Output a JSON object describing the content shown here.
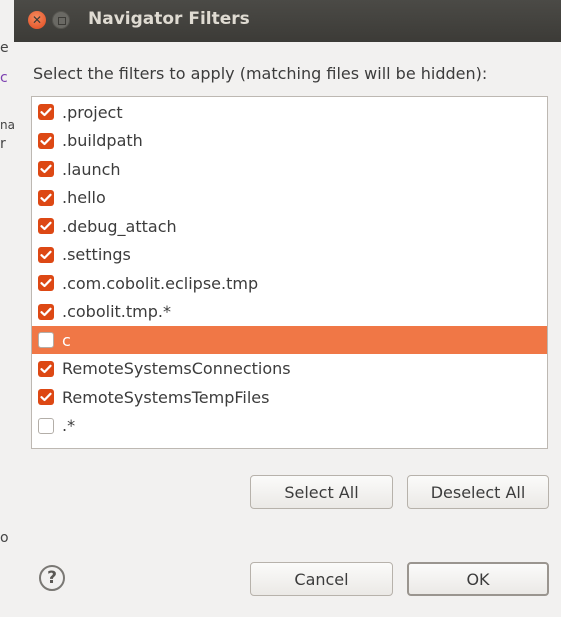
{
  "window": {
    "title": "Navigator Filters"
  },
  "dialog": {
    "instruction": "Select the filters to apply (matching files will be hidden):",
    "filters": [
      {
        "label": ".project",
        "checked": true,
        "selected": false
      },
      {
        "label": ".buildpath",
        "checked": true,
        "selected": false
      },
      {
        "label": ".launch",
        "checked": true,
        "selected": false
      },
      {
        "label": ".hello",
        "checked": true,
        "selected": false
      },
      {
        "label": ".debug_attach",
        "checked": true,
        "selected": false
      },
      {
        "label": ".settings",
        "checked": true,
        "selected": false
      },
      {
        "label": ".com.cobolit.eclipse.tmp",
        "checked": true,
        "selected": false
      },
      {
        "label": ".cobolit.tmp.*",
        "checked": true,
        "selected": false
      },
      {
        "label": "c",
        "checked": false,
        "selected": true
      },
      {
        "label": "RemoteSystemsConnections",
        "checked": true,
        "selected": false
      },
      {
        "label": "RemoteSystemsTempFiles",
        "checked": true,
        "selected": false
      },
      {
        "label": ".*",
        "checked": false,
        "selected": false
      }
    ],
    "select_all_label": "Select All",
    "deselect_all_label": "Deselect All",
    "cancel_label": "Cancel",
    "ok_label": "OK",
    "help_glyph": "?"
  },
  "icons": {
    "close": "close-icon",
    "minimize": "minimize-icon",
    "help": "help-icon",
    "checkbox_checked": "checkbox-checked-icon",
    "checkbox_unchecked": "checkbox-unchecked-icon"
  },
  "colors": {
    "accent": "#dd4814",
    "selection": "#f07746",
    "titlebar": "#3c3b37"
  },
  "backdrop": {
    "fragments": [
      "e",
      "c",
      "na",
      "r",
      "o"
    ]
  }
}
